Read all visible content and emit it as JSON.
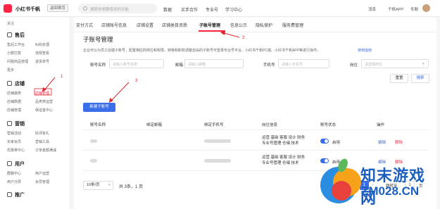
{
  "header": {
    "logo_text": "小红书千帆",
    "home_tag": "返回首页",
    "search_placeholder": "搜索你想要使用的功能",
    "nav": [
      "数据",
      "买手合作",
      "专业号",
      "学习中心"
    ],
    "messages": "消息",
    "app": "千帆APP",
    "user": "冬鼓"
  },
  "sidebar": {
    "top_item": "关注",
    "sections": [
      {
        "title": "售后",
        "items": [
          "售后工作台",
          "纠纷处理",
          "小额打款",
          "违规查看",
          "问题商品管理",
          "退货单号",
          "更多"
        ]
      },
      {
        "title": "店铺",
        "items": [
          "店铺装修",
          "店铺管理",
          "店铺数据",
          "品类类运营",
          "店铺管理",
          "保证金中心"
        ]
      },
      {
        "title": "营销",
        "items": [
          "营销活动",
          "好评有礼",
          "买家会员",
          "营销工具",
          "优惠券中心",
          "订单金额满减"
        ]
      },
      {
        "title": "用户",
        "items": [
          "群聊中心",
          "用户运营",
          "用户分层",
          "会员管理"
        ]
      },
      {
        "title": "推广",
        "items": []
      }
    ],
    "active_item": "店铺管理"
  },
  "tabs": [
    "支付方式",
    "店铺账号信息",
    "店铺设置",
    "店铺类目资质",
    "子账号管理",
    "信息公示",
    "隐私保护",
    "服务费管理"
  ],
  "active_tab": "子账号管理",
  "page": {
    "title": "子账号管理",
    "description": "企业可以为员工创建子账号，配置相应的岗位和权限，转移和职权调整自由的子账号可登录专业号平台、小红书千帆PC端、小红书千帆APP等进行操作。",
    "help_link": "使用指南"
  },
  "filters": {
    "account_name_label": "账号名称",
    "account_name_placeholder": "请输入账号名称",
    "email_label": "邮箱",
    "email_placeholder": "请输入邮箱",
    "phone_label": "手机号",
    "phone_placeholder": "请输入手机号",
    "role_label": "岗位",
    "role_placeholder": "请选择岗位",
    "reset": "重置",
    "search": "搜索"
  },
  "new_button": "新建子账号",
  "table": {
    "headers": [
      "账号名称",
      "绑定邮箱",
      "绑定手机号",
      "岗位信息",
      "账号状态",
      "操作"
    ],
    "rows": [
      {
        "roles": [
          "运营 基础 客服 设计 财务",
          "专业号管理 仓储 技术"
        ],
        "status": "启用",
        "edit": "编辑",
        "delete": "删除"
      },
      {
        "roles": [
          "运营 基础 客服 设计 财务",
          "专业号管理 仓储 技术"
        ],
        "status": "启用",
        "edit": "编辑",
        "delete": "删除"
      }
    ]
  },
  "pagination": {
    "page_size": "10条/页",
    "total": "共 3条，1 页",
    "current": "1",
    "goto_label": "跳转至",
    "goto_value": "1",
    "goto_suffix": "页"
  },
  "annotations": [
    "1",
    "2",
    "3"
  ],
  "watermark": {
    "text": "知末游戏网",
    "sub": "ZM028.CN"
  },
  "colors": {
    "brand": "#ff2442",
    "primary": "#3a6ee8",
    "annotation": "#e0242e"
  }
}
